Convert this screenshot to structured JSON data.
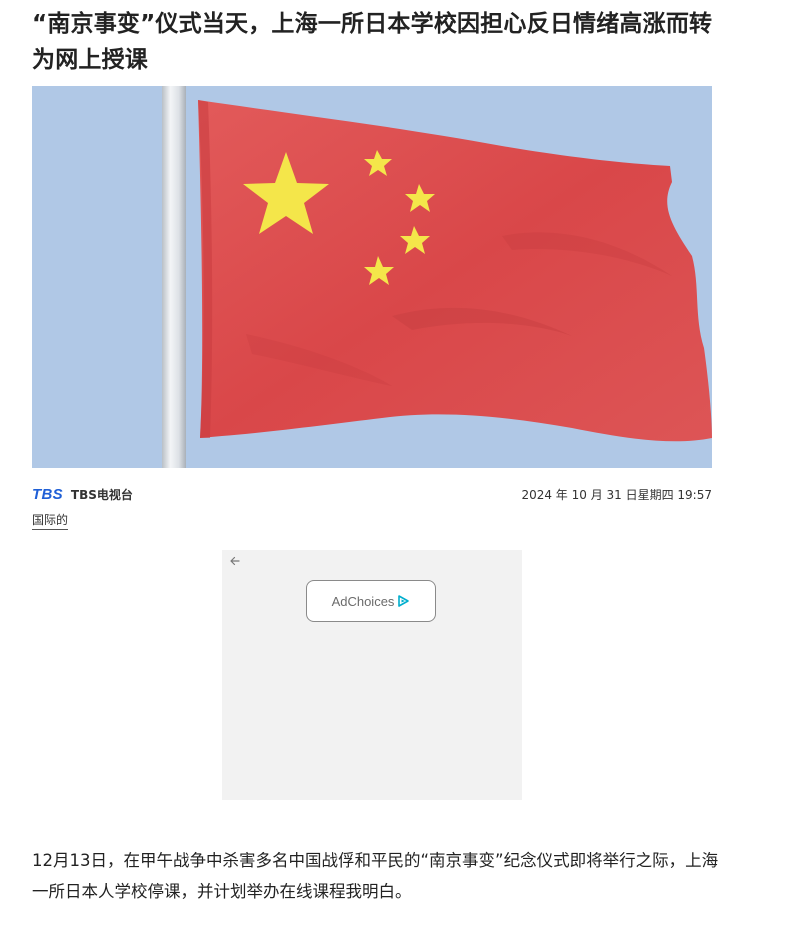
{
  "article": {
    "headline": "“南京事变”仪式当天，上海一所日本学校因担心反日情绪高涨而转为网上授课",
    "hero_image": {
      "subject": "flag-icon",
      "colors": {
        "sky": "#b0c8e6",
        "flag_red": "#dc4a4c",
        "star_yellow": "#f4e64a",
        "pole": "#d8dde3"
      }
    },
    "source": {
      "logo_text": "TBS",
      "name": "TBS电视台",
      "logo_color": "#1f5fd6"
    },
    "published": "2024 年 10 月 31 日星期四 19:57",
    "category": "国际的",
    "body": [
      "12月13日，在甲午战争中杀害多名中国战俘和平民的“南京事变”纪念仪式即将举行之际，上海一所日本人学校停课，并计划举办在线课程我明白。"
    ]
  },
  "ad": {
    "back_icon": "arrow-left-icon",
    "adchoices_label": "AdChoices",
    "adchoices_icon": "adchoices-icon",
    "adchoices_color": "#00aecd"
  }
}
